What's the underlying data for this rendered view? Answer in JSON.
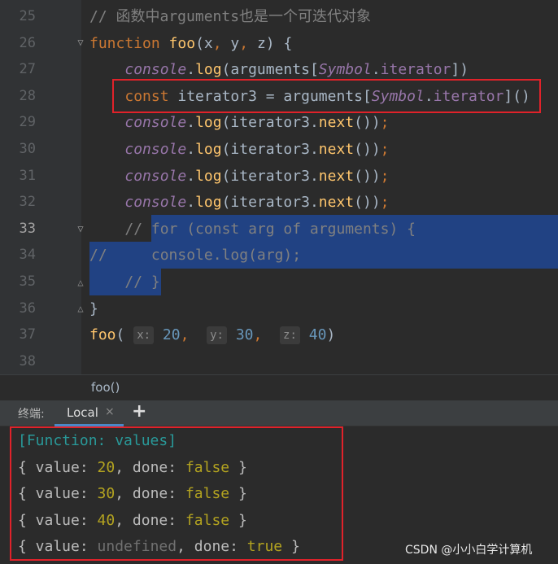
{
  "editor": {
    "lines": [
      {
        "num": "25",
        "tokens": [
          {
            "t": "// 函数中arguments也是一个可迭代对象",
            "c": "cm"
          }
        ]
      },
      {
        "num": "26",
        "tokens": [
          {
            "t": "function",
            "c": "kw"
          },
          {
            "t": " "
          },
          {
            "t": "foo",
            "c": "fn"
          },
          {
            "t": "(x"
          },
          {
            "t": ",",
            "c": "kw"
          },
          {
            "t": " y"
          },
          {
            "t": ",",
            "c": "kw"
          },
          {
            "t": " z) {"
          }
        ]
      },
      {
        "num": "27",
        "tokens": [
          {
            "t": "    "
          },
          {
            "t": "console",
            "c": "cons"
          },
          {
            "t": "."
          },
          {
            "t": "log",
            "c": "meth"
          },
          {
            "t": "(arguments["
          },
          {
            "t": "Symbol",
            "c": "cons"
          },
          {
            "t": "."
          },
          {
            "t": "iterator",
            "c": "prop"
          },
          {
            "t": "])"
          }
        ]
      },
      {
        "num": "28",
        "tokens": [
          {
            "t": "    "
          },
          {
            "t": "const",
            "c": "kw"
          },
          {
            "t": " iterator3 = arguments["
          },
          {
            "t": "Symbol",
            "c": "cons"
          },
          {
            "t": "."
          },
          {
            "t": "iterator",
            "c": "prop"
          },
          {
            "t": "]()"
          }
        ]
      },
      {
        "num": "29",
        "tokens": [
          {
            "t": "    "
          },
          {
            "t": "console",
            "c": "cons"
          },
          {
            "t": "."
          },
          {
            "t": "log",
            "c": "meth"
          },
          {
            "t": "(iterator3."
          },
          {
            "t": "next",
            "c": "meth"
          },
          {
            "t": "())"
          },
          {
            "t": ";",
            "c": "kw"
          }
        ]
      },
      {
        "num": "30",
        "tokens": [
          {
            "t": "    "
          },
          {
            "t": "console",
            "c": "cons"
          },
          {
            "t": "."
          },
          {
            "t": "log",
            "c": "meth"
          },
          {
            "t": "(iterator3."
          },
          {
            "t": "next",
            "c": "meth"
          },
          {
            "t": "())"
          },
          {
            "t": ";",
            "c": "kw"
          }
        ]
      },
      {
        "num": "31",
        "tokens": [
          {
            "t": "    "
          },
          {
            "t": "console",
            "c": "cons"
          },
          {
            "t": "."
          },
          {
            "t": "log",
            "c": "meth"
          },
          {
            "t": "(iterator3."
          },
          {
            "t": "next",
            "c": "meth"
          },
          {
            "t": "())"
          },
          {
            "t": ";",
            "c": "kw"
          }
        ]
      },
      {
        "num": "32",
        "tokens": [
          {
            "t": "    "
          },
          {
            "t": "console",
            "c": "cons"
          },
          {
            "t": "."
          },
          {
            "t": "log",
            "c": "meth"
          },
          {
            "t": "(iterator3."
          },
          {
            "t": "next",
            "c": "meth"
          },
          {
            "t": "())"
          },
          {
            "t": ";",
            "c": "kw"
          }
        ]
      },
      {
        "num": "33",
        "tokens": [
          {
            "t": "    "
          },
          {
            "t": "// for (const arg of arguments) {",
            "c": "cm"
          }
        ]
      },
      {
        "num": "34",
        "tokens": [
          {
            "t": "//     console.log(arg);",
            "c": "cm"
          }
        ]
      },
      {
        "num": "35",
        "tokens": [
          {
            "t": "    "
          },
          {
            "t": "// }",
            "c": "cm"
          }
        ]
      },
      {
        "num": "36",
        "tokens": [
          {
            "t": "}"
          }
        ]
      },
      {
        "num": "37",
        "tokens": [
          {
            "t": "foo",
            "c": "fn"
          },
          {
            "t": "( "
          },
          {
            "t": "x:",
            "c": "hint"
          },
          {
            "t": " "
          },
          {
            "t": "20",
            "c": "num"
          },
          {
            "t": ",",
            "c": "kw"
          },
          {
            "t": "  "
          },
          {
            "t": "y:",
            "c": "hint"
          },
          {
            "t": " "
          },
          {
            "t": "30",
            "c": "num"
          },
          {
            "t": ",",
            "c": "kw"
          },
          {
            "t": "  "
          },
          {
            "t": "z:",
            "c": "hint"
          },
          {
            "t": " "
          },
          {
            "t": "40",
            "c": "num"
          },
          {
            "t": ")"
          }
        ]
      },
      {
        "num": "38",
        "tokens": []
      }
    ]
  },
  "breadcrumb": {
    "label": "foo()"
  },
  "terminal": {
    "label": "终端:",
    "tab_label": "Local",
    "close_glyph": "×",
    "add_glyph": "+",
    "output": [
      [
        {
          "t": "[Function: values]",
          "c": "tcyan"
        }
      ],
      [
        {
          "t": "{ value: "
        },
        {
          "t": "20",
          "c": "tyel"
        },
        {
          "t": ", done: "
        },
        {
          "t": "false",
          "c": "tyel"
        },
        {
          "t": " }"
        }
      ],
      [
        {
          "t": "{ value: "
        },
        {
          "t": "30",
          "c": "tyel"
        },
        {
          "t": ", done: "
        },
        {
          "t": "false",
          "c": "tyel"
        },
        {
          "t": " }"
        }
      ],
      [
        {
          "t": "{ value: "
        },
        {
          "t": "40",
          "c": "tyel"
        },
        {
          "t": ", done: "
        },
        {
          "t": "false",
          "c": "tyel"
        },
        {
          "t": " }"
        }
      ],
      [
        {
          "t": "{ value: "
        },
        {
          "t": "undefined",
          "c": "tgray"
        },
        {
          "t": ", done: "
        },
        {
          "t": "true",
          "c": "tyel"
        },
        {
          "t": " }"
        }
      ]
    ]
  },
  "watermark": "CSDN @小小白学计算机",
  "colors": {
    "highlight_box": "#e0222a",
    "selection": "#214283"
  }
}
